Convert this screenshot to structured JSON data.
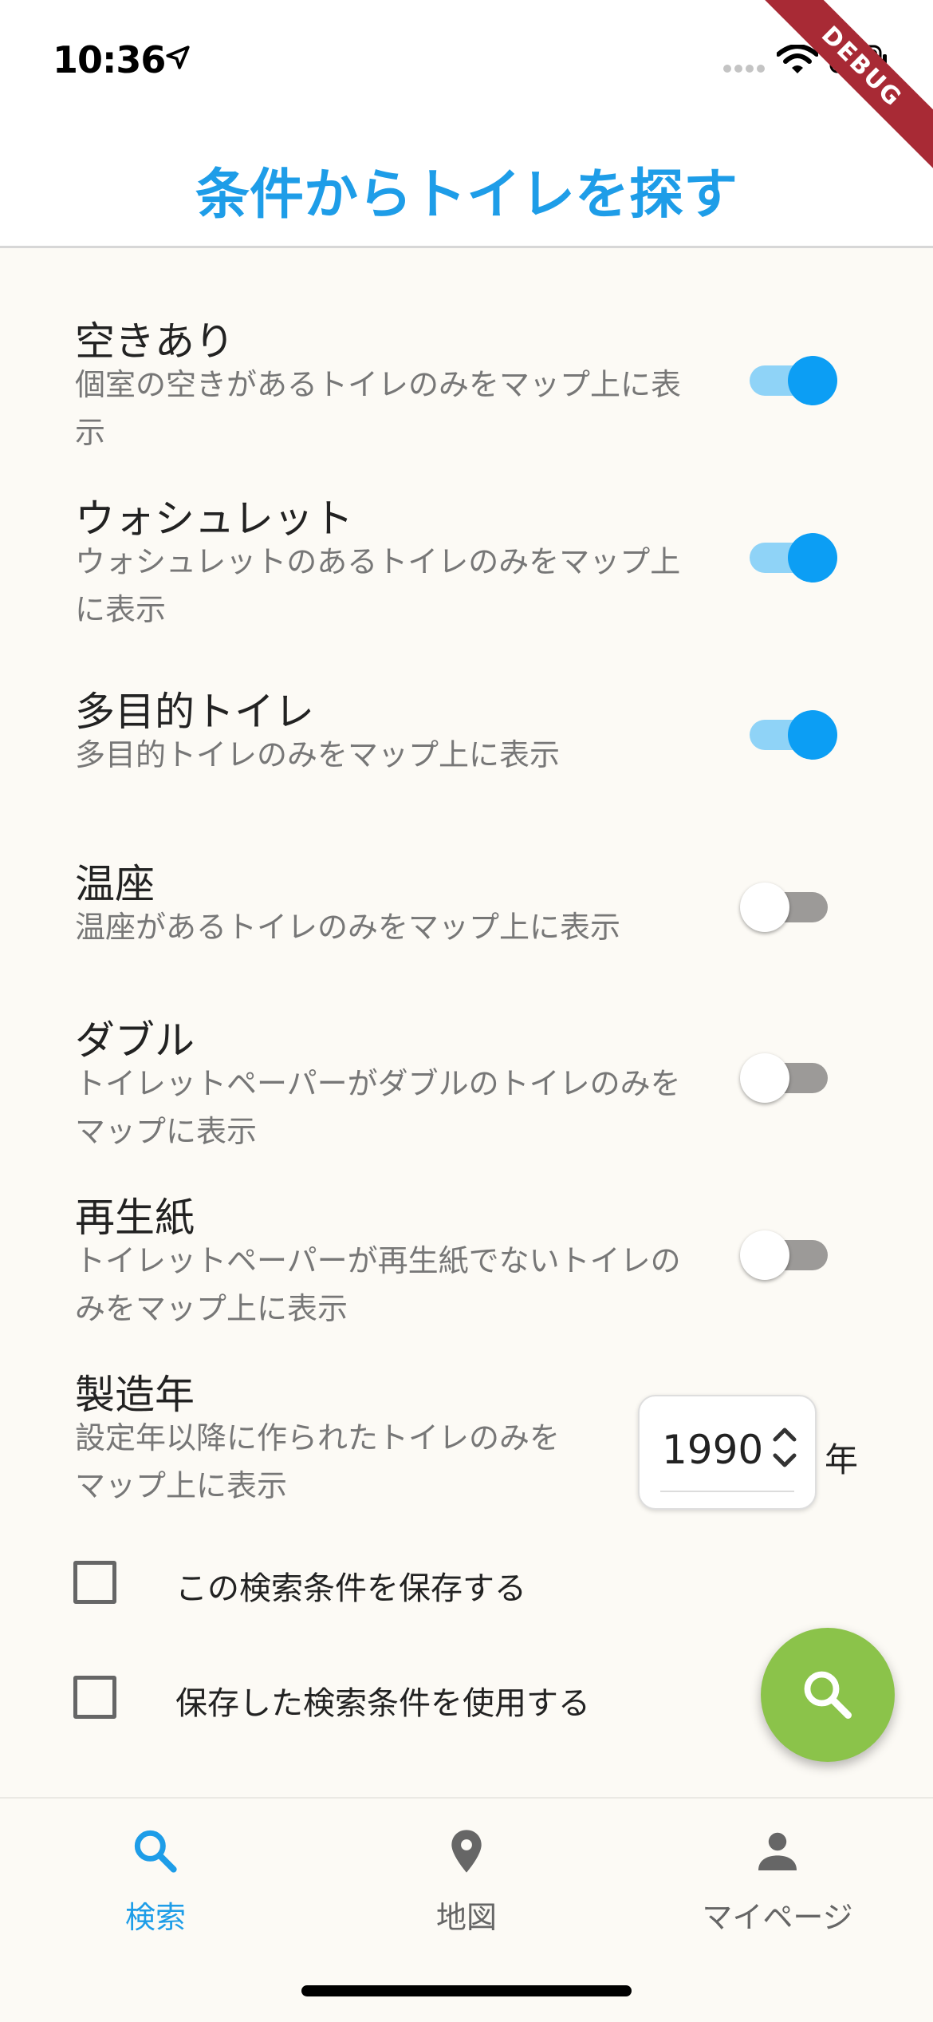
{
  "status_bar": {
    "time": "10:36"
  },
  "debug_banner": "DEBUG",
  "app_bar": {
    "title": "条件からトイレを探す"
  },
  "filters": [
    {
      "title": "空きあり",
      "description": "個室の空きがあるトイレのみをマップ上に表示",
      "enabled": true
    },
    {
      "title": "ウォシュレット",
      "description": "ウォシュレットのあるトイレのみをマップ上に表示",
      "enabled": true
    },
    {
      "title": "多目的トイレ",
      "description": "多目的トイレのみをマップ上に表示",
      "enabled": true
    },
    {
      "title": "温座",
      "description": "温座があるトイレのみをマップ上に表示",
      "enabled": false
    },
    {
      "title": "ダブル",
      "description": "トイレットペーパーがダブルのトイレのみをマップに表示",
      "enabled": false
    },
    {
      "title": "再生紙",
      "description": "トイレットペーパーが再生紙でないトイレのみをマップ上に表示",
      "enabled": false
    }
  ],
  "year_filter": {
    "title": "製造年",
    "description": "設定年以降に作られたトイレのみをマップ上に表示",
    "value": "1990",
    "unit": "年"
  },
  "options": {
    "save_condition": {
      "label": "この検索条件を保存する",
      "checked": false
    },
    "use_saved_condition": {
      "label": "保存した検索条件を使用する",
      "checked": false
    }
  },
  "fab": {
    "icon": "search-icon",
    "color": "#8bc34a"
  },
  "bottom_nav": {
    "items": [
      {
        "label": "検索",
        "icon": "search-icon",
        "active": true
      },
      {
        "label": "地図",
        "icon": "map-pin-icon",
        "active": false
      },
      {
        "label": "マイページ",
        "icon": "person-icon",
        "active": false
      }
    ]
  },
  "colors": {
    "accent": "#1e9de8",
    "switch_on": "#0c9ef4",
    "fab": "#8bc34a",
    "background": "#fcfaf5"
  }
}
